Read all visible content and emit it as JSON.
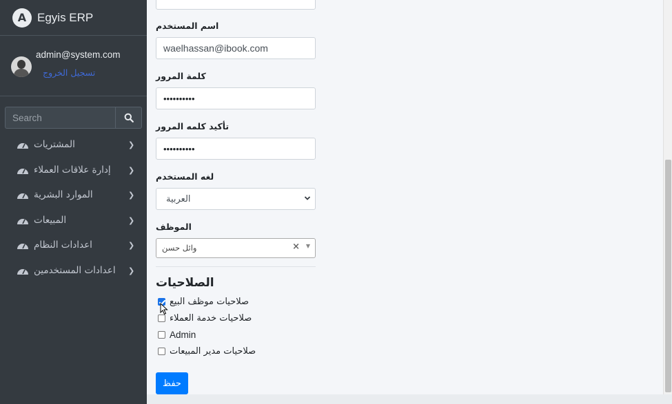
{
  "brand": {
    "title": "Egyis ERP",
    "logo_letter": "A"
  },
  "user": {
    "email": "admin@system.com",
    "logout_label": "تسجيل الخروج"
  },
  "search": {
    "placeholder": "Search"
  },
  "sidebar": {
    "items": [
      {
        "label": "المشتريات",
        "icon": "dashboard-icon"
      },
      {
        "label": "إدارة علاقات العملاء",
        "icon": "dashboard-icon"
      },
      {
        "label": "الموارد البشرية",
        "icon": "dashboard-icon"
      },
      {
        "label": "المبيعات",
        "icon": "dashboard-icon"
      },
      {
        "label": "اعدادات النظام",
        "icon": "dashboard-icon"
      },
      {
        "label": "اعدادات المستخدمين",
        "icon": "dashboard-icon"
      }
    ]
  },
  "form": {
    "username_label": "اسم المستخدم",
    "username_value": "waelhassan@ibook.com",
    "password_label": "كلمة المرور",
    "password_value": "••••••••••",
    "confirm_label": "تأكيد كلمه المرور",
    "confirm_value": "••••••••••",
    "language_label": "لغه المستخدم",
    "language_value": "العربية",
    "employee_label": "الموظف",
    "employee_value": "وائل حسن",
    "employee_clear": "×",
    "employee_arrow": "▼"
  },
  "permissions": {
    "title": "الصلاحيات",
    "items": [
      {
        "label": "صلاحيات موظف البيع",
        "checked": true
      },
      {
        "label": "صلاحيات خدمة العملاء",
        "checked": false
      },
      {
        "label": "Admin",
        "checked": false
      },
      {
        "label": "صلاحيات مدير المبيعات",
        "checked": false
      }
    ]
  },
  "actions": {
    "save_label": "حفظ"
  },
  "colors": {
    "sidebar_bg": "#343a40",
    "primary": "#007bff",
    "content_bg": "#f4f6f9",
    "link": "#3f6ad8"
  }
}
